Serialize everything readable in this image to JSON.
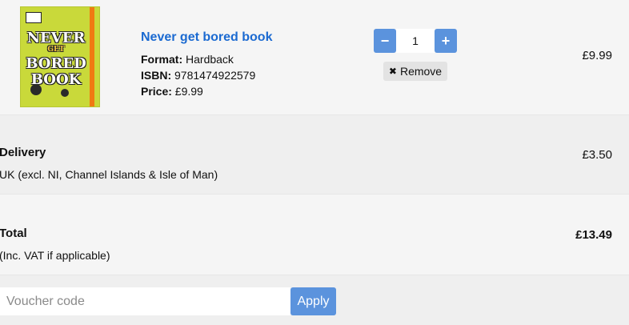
{
  "item": {
    "title": "Never get bored book",
    "format_label": "Format:",
    "format_value": " Hardback",
    "isbn_label": "ISBN:",
    "isbn_value": " 9781474922579",
    "price_label": "Price:",
    "price_value": " £9.99",
    "line_total": "£9.99",
    "quantity": "1",
    "minus": "−",
    "plus": "+",
    "remove_label": "Remove",
    "remove_icon": "✖",
    "cover_words": [
      "NEVER",
      "GET",
      "BORED",
      "BOOK"
    ]
  },
  "delivery": {
    "label": "Delivery",
    "detail": "UK (excl. NI, Channel Islands & Isle of Man)",
    "price": "£3.50"
  },
  "total": {
    "label": "Total",
    "note": "(Inc. VAT if applicable)",
    "amount": "£13.49"
  },
  "voucher": {
    "placeholder": "Voucher code",
    "apply_label": "Apply"
  },
  "colors": {
    "accent": "#5b93dd",
    "link": "#1b6ad1",
    "cover": "#c9d93a"
  }
}
